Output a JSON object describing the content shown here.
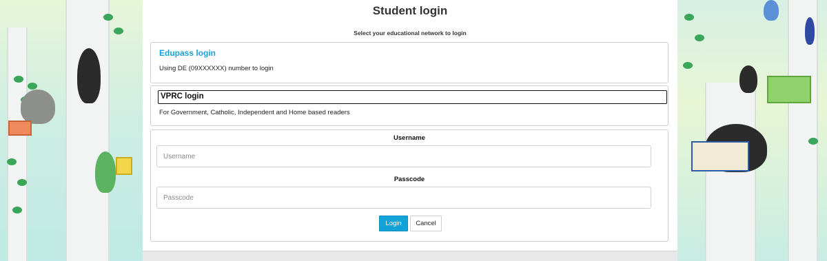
{
  "page": {
    "title": "Student login",
    "subtitle": "Select your educational network to login"
  },
  "networks": [
    {
      "title": "Edupass login",
      "description": "Using DE (09XXXXXX) number to login"
    },
    {
      "title": "VPRC login",
      "description": "For Government, Catholic, Independent and Home based readers"
    }
  ],
  "form": {
    "username_label": "Username",
    "username_placeholder": "Username",
    "passcode_label": "Passcode",
    "passcode_placeholder": "Passcode",
    "login_label": "Login",
    "cancel_label": "Cancel"
  },
  "colors": {
    "link": "#1a9fd6",
    "login_button": "#14a3d8"
  },
  "decor": {
    "left_icon": "illustration-birds-animals-reading-icon",
    "right_icon": "illustration-birds-reading-books-icon"
  }
}
